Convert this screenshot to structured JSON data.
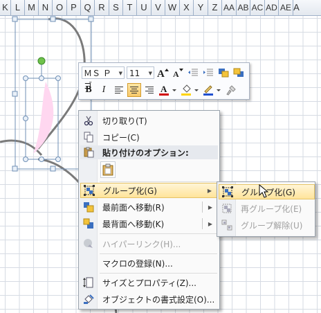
{
  "columns": [
    "K",
    "L",
    "M",
    "N",
    "O",
    "P",
    "Q",
    "R",
    "S",
    "T",
    "U",
    "V",
    "W",
    "X",
    "Y",
    "Z",
    "AA",
    "AB",
    "AC",
    "AD",
    "AE",
    "A"
  ],
  "mini_toolbar": {
    "font_name": "ＭＳ Ｐゴ",
    "font_size": "11",
    "buttons": [
      "grow-font",
      "shrink-font",
      "decrease-indent",
      "increase-indent",
      "bring-forward",
      "send-backward",
      "bold",
      "italic",
      "align-left",
      "align-center",
      "align-right",
      "font-color",
      "fill-color",
      "line-color",
      "format-painter"
    ],
    "bold_label": "B",
    "italic_label": "I"
  },
  "context_menu": {
    "items": [
      {
        "label": "切り取り(T)",
        "icon": "scissors-icon",
        "enabled": true
      },
      {
        "label": "コピー(C)",
        "icon": "copy-icon",
        "enabled": true
      },
      {
        "label": "貼り付けのオプション:",
        "icon": "paste-options-icon",
        "header": true
      },
      {
        "label": "グループ化(G)",
        "icon": "group-icon",
        "enabled": true,
        "submenu": true
      },
      {
        "label": "最前面へ移動(R)",
        "icon": "bring-to-front-icon",
        "enabled": true,
        "submenu": true
      },
      {
        "label": "最背面へ移動(K)",
        "icon": "send-to-back-icon",
        "enabled": true,
        "submenu": true
      },
      {
        "label": "ハイパーリンク(H)...",
        "icon": "hyperlink-icon",
        "enabled": false
      },
      {
        "label": "マクロの登録(N)...",
        "icon": "",
        "enabled": true
      },
      {
        "label": "サイズとプロパティ(Z)...",
        "icon": "size-properties-icon",
        "enabled": true
      },
      {
        "label": "オブジェクトの書式設定(O)...",
        "icon": "format-object-icon",
        "enabled": true
      }
    ]
  },
  "group_submenu": {
    "items": [
      {
        "label": "グループ化(G)",
        "icon": "group-icon",
        "enabled": true
      },
      {
        "label": "再グループ化(E)",
        "icon": "regroup-icon",
        "enabled": false
      },
      {
        "label": "グループ解除(U)",
        "icon": "ungroup-icon",
        "enabled": false
      }
    ]
  },
  "colors": {
    "highlight": "#ffe49a",
    "selection_border": "#6f8fb5",
    "shape_fill": "#ffd7f0",
    "font_color_bar": "#d00000",
    "fill_color_bar": "#ffd400",
    "line_color_bar": "#2050d0",
    "rotation_handle": "#6fc24b"
  }
}
